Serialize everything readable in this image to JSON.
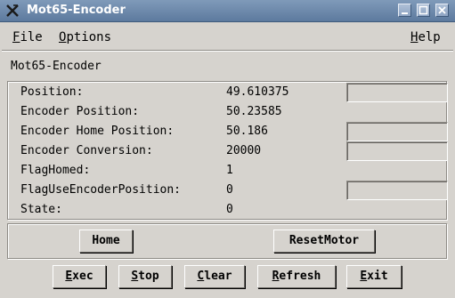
{
  "window": {
    "title": "Mot65-Encoder"
  },
  "menubar": {
    "file": {
      "mnemonic": "F",
      "rest": "ile"
    },
    "options": {
      "mnemonic": "O",
      "rest": "ptions"
    },
    "help": {
      "mnemonic": "H",
      "rest": "elp"
    }
  },
  "section_title": "Mot65-Encoder",
  "rows": [
    {
      "label": "Position:",
      "value": "49.610375"
    },
    {
      "label": "Encoder Position:",
      "value": "50.23585"
    },
    {
      "label": "Encoder Home Position:",
      "value": "50.186"
    },
    {
      "label": "Encoder Conversion:",
      "value": "20000"
    },
    {
      "label": "FlagHomed:",
      "value": "1"
    },
    {
      "label": "FlagUseEncoderPosition:",
      "value": "0"
    },
    {
      "label": "State:",
      "value": "0"
    }
  ],
  "entries": {
    "position": "",
    "encoder_home_position": "",
    "encoder_conversion": "",
    "flag_use_encoder_position": ""
  },
  "buttons": {
    "home": "Home",
    "reset_motor": "ResetMotor",
    "exec": {
      "mnemonic": "E",
      "rest": "xec"
    },
    "stop": {
      "mnemonic": "S",
      "rest": "top"
    },
    "clear": {
      "mnemonic": "C",
      "rest": "lear"
    },
    "refresh": {
      "mnemonic": "R",
      "rest": "efresh"
    },
    "exit": {
      "mnemonic": "E",
      "rest": "xit"
    }
  },
  "colors": {
    "titlebar": "#6f8bb0",
    "background": "#d6d3ce",
    "title_text": "#ffffff"
  },
  "icons": {
    "app": "x-logo-icon",
    "minimize": "minimize-icon",
    "maximize": "maximize-icon",
    "close": "close-icon"
  }
}
